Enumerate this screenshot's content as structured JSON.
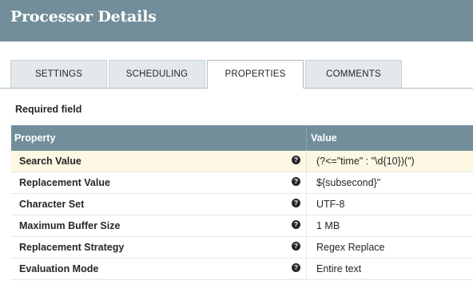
{
  "dialog": {
    "title": "Processor Details"
  },
  "tabs": [
    {
      "label": "SETTINGS",
      "active": false
    },
    {
      "label": "SCHEDULING",
      "active": false
    },
    {
      "label": "PROPERTIES",
      "active": true
    },
    {
      "label": "COMMENTS",
      "active": false
    }
  ],
  "properties": {
    "required_label": "Required field",
    "columns": {
      "property": "Property",
      "value": "Value"
    },
    "rows": [
      {
        "name": "Search Value",
        "value": "(?<=\"time\" : \"\\d{10})(\")",
        "selected": true,
        "help_icon": "question-circle"
      },
      {
        "name": "Replacement Value",
        "value": "${subsecond}\"",
        "selected": false,
        "help_icon": "question-circle"
      },
      {
        "name": "Character Set",
        "value": "UTF-8",
        "selected": false,
        "help_icon": "question-circle"
      },
      {
        "name": "Maximum Buffer Size",
        "value": "1 MB",
        "selected": false,
        "help_icon": "question-circle"
      },
      {
        "name": "Replacement Strategy",
        "value": "Regex Replace",
        "selected": false,
        "help_icon": "question-circle"
      },
      {
        "name": "Evaluation Mode",
        "value": "Entire text",
        "selected": false,
        "help_icon": "question-circle"
      }
    ]
  },
  "colors": {
    "header_bg": "#728e9b",
    "selected_row_bg": "#fcf8e3",
    "tab_bg": "#e3e8eb"
  }
}
